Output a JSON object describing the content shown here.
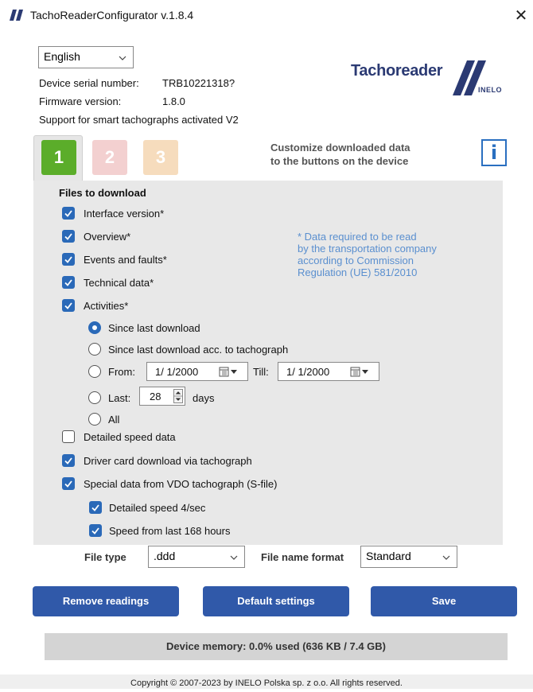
{
  "window": {
    "title": "TachoReaderConfigurator v.1.8.4",
    "close_glyph": "✕"
  },
  "language": {
    "selected": "English"
  },
  "device": {
    "serial_label": "Device serial number:",
    "serial_value": "TRB10221318?",
    "firmware_label": "Firmware version:",
    "firmware_value": "1.8.0",
    "smart_support": "Support for smart tachographs activated V2"
  },
  "logo": {
    "name": "Tachoreader",
    "sub": "INELO"
  },
  "tabs": [
    {
      "label": "1",
      "color": "#5bad2a",
      "active": true
    },
    {
      "label": "2",
      "color": "#f3d0d0",
      "active": false
    },
    {
      "label": "3",
      "color": "#f6dcbd",
      "active": false
    }
  ],
  "tab_hint": [
    "Customize downloaded data",
    "to the buttons on the device"
  ],
  "info_icon": "info-icon",
  "files": {
    "heading": "Files to download",
    "items": [
      {
        "label": "Interface version*",
        "checked": true
      },
      {
        "label": "Overview*",
        "checked": true
      },
      {
        "label": "Events and faults*",
        "checked": true
      },
      {
        "label": "Technical data*",
        "checked": true
      },
      {
        "label": "Activities*",
        "checked": true
      }
    ],
    "required_note": [
      "* Data required to be read",
      "by the transportation company",
      "according to Commission",
      "Regulation (UE) 581/2010"
    ]
  },
  "activities": {
    "options": [
      {
        "label": "Since last download",
        "selected": true
      },
      {
        "label": "Since last download acc. to tachograph",
        "selected": false
      },
      {
        "label": "From:",
        "selected": false
      },
      {
        "label": "Last:",
        "selected": false
      },
      {
        "label": "All",
        "selected": false
      }
    ],
    "from_date": "1/  1/2000",
    "till_label": "Till:",
    "till_date": "1/  1/2000",
    "last_value": "28",
    "days_label": "days"
  },
  "extra": [
    {
      "label": "Detailed speed data",
      "checked": false
    },
    {
      "label": "Driver card download via tachograph",
      "checked": true
    },
    {
      "label": "Special data from VDO tachograph (S-file)",
      "checked": true
    }
  ],
  "sfile": [
    {
      "label": "Detailed speed 4/sec",
      "checked": true
    },
    {
      "label": "Speed from last 168 hours",
      "checked": true
    }
  ],
  "file_type": {
    "label": "File type",
    "selected": ".ddd"
  },
  "file_name_format": {
    "label": "File name format",
    "selected": "Standard"
  },
  "buttons": {
    "remove": "Remove readings",
    "defaults": "Default settings",
    "save": "Save"
  },
  "memory": "Device memory: 0.0% used (636 KB / 7.4 GB)",
  "footer": "Copyright © 2007-2023 by INELO Polska sp. z o.o. All rights reserved.",
  "colors": {
    "accent": "#3059a9",
    "check": "#2a69b8",
    "note": "#5a8fcf"
  }
}
